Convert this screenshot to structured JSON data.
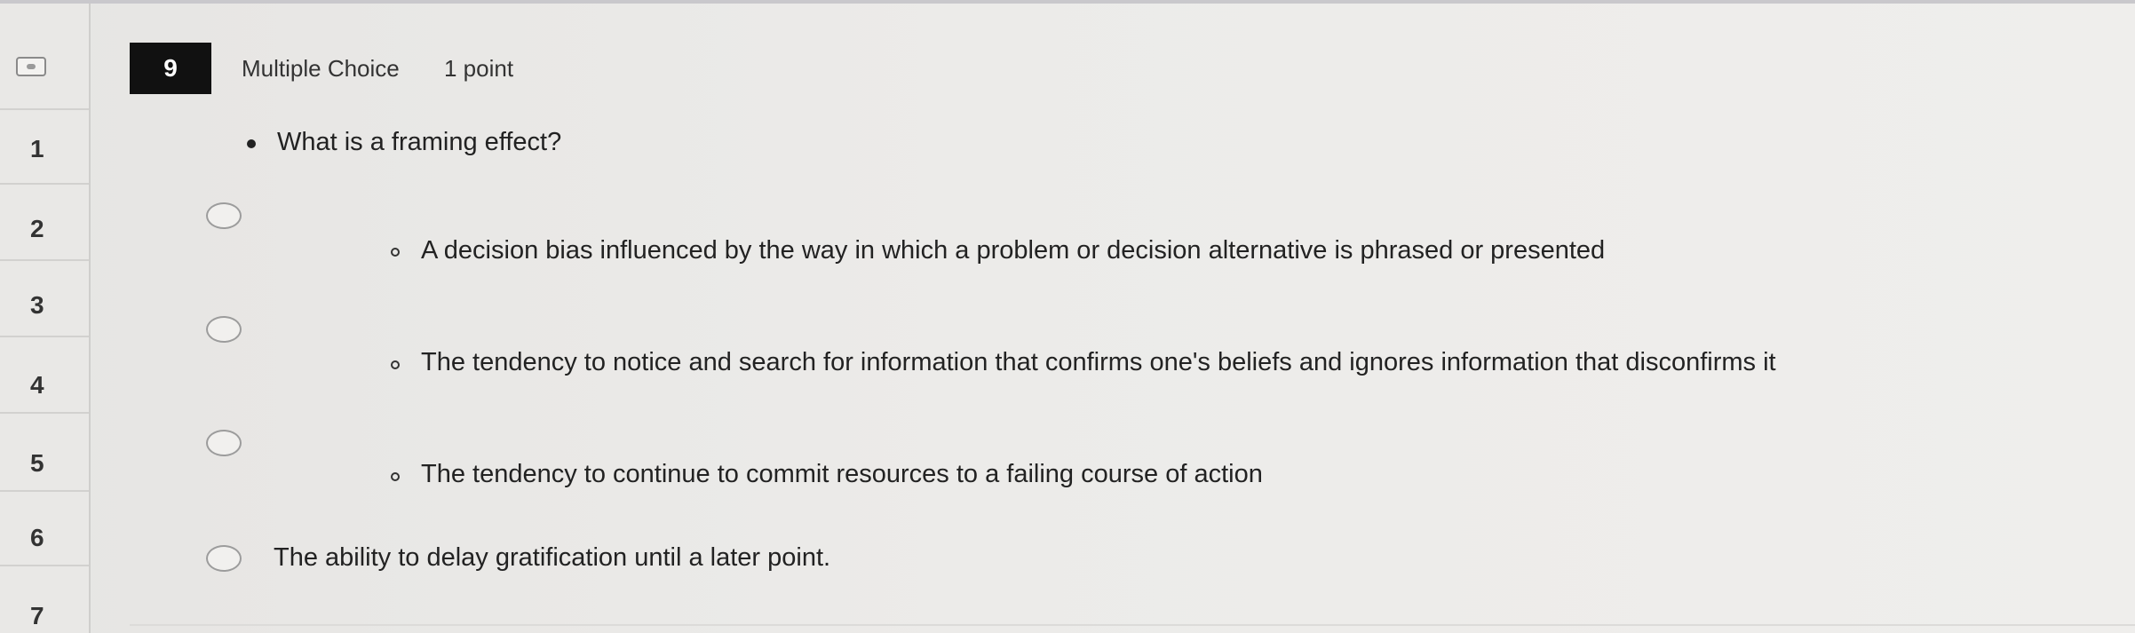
{
  "navigator": {
    "items": [
      "1",
      "2",
      "3",
      "4",
      "5",
      "6",
      "7"
    ]
  },
  "question": {
    "number": "9",
    "type": "Multiple Choice",
    "points": "1 point",
    "prompt": "What is a framing effect?",
    "options": [
      "A decision bias influenced by the way in which a problem or decision alternative is phrased or presented",
      "The tendency to notice and search for information that confirms one's beliefs and ignores information that disconfirms it",
      "The tendency to continue to commit resources to a failing course of action",
      "The ability to delay gratification until a later point."
    ],
    "selected_option": null
  },
  "colors": {
    "badge_background": "#111111",
    "badge_text": "#ffffff",
    "page_background": "#ecebe9"
  }
}
